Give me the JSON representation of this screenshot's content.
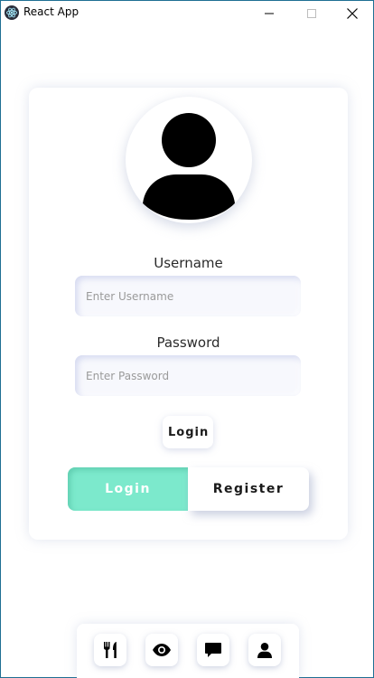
{
  "window": {
    "title": "React App",
    "icons": [
      "electron-icon",
      "minimize-icon",
      "maximize-icon",
      "close-icon"
    ]
  },
  "login_card": {
    "avatar_icon": "user-avatar-icon",
    "username_label": "Username",
    "username_placeholder": "Enter Username",
    "username_value": "",
    "password_label": "Password",
    "password_placeholder": "Enter Password",
    "password_value": "",
    "submit_label": "Login",
    "toggle": {
      "login_label": "Login",
      "register_label": "Register",
      "active": "Login"
    }
  },
  "bottom_nav": {
    "items": [
      {
        "icon": "utensils-icon"
      },
      {
        "icon": "eye-icon"
      },
      {
        "icon": "comment-icon"
      },
      {
        "icon": "user-icon"
      }
    ]
  },
  "colors": {
    "toggle_active": "#7ce9cc",
    "window_border": "#1f6f93",
    "text_dark": "#1a1a1a"
  }
}
